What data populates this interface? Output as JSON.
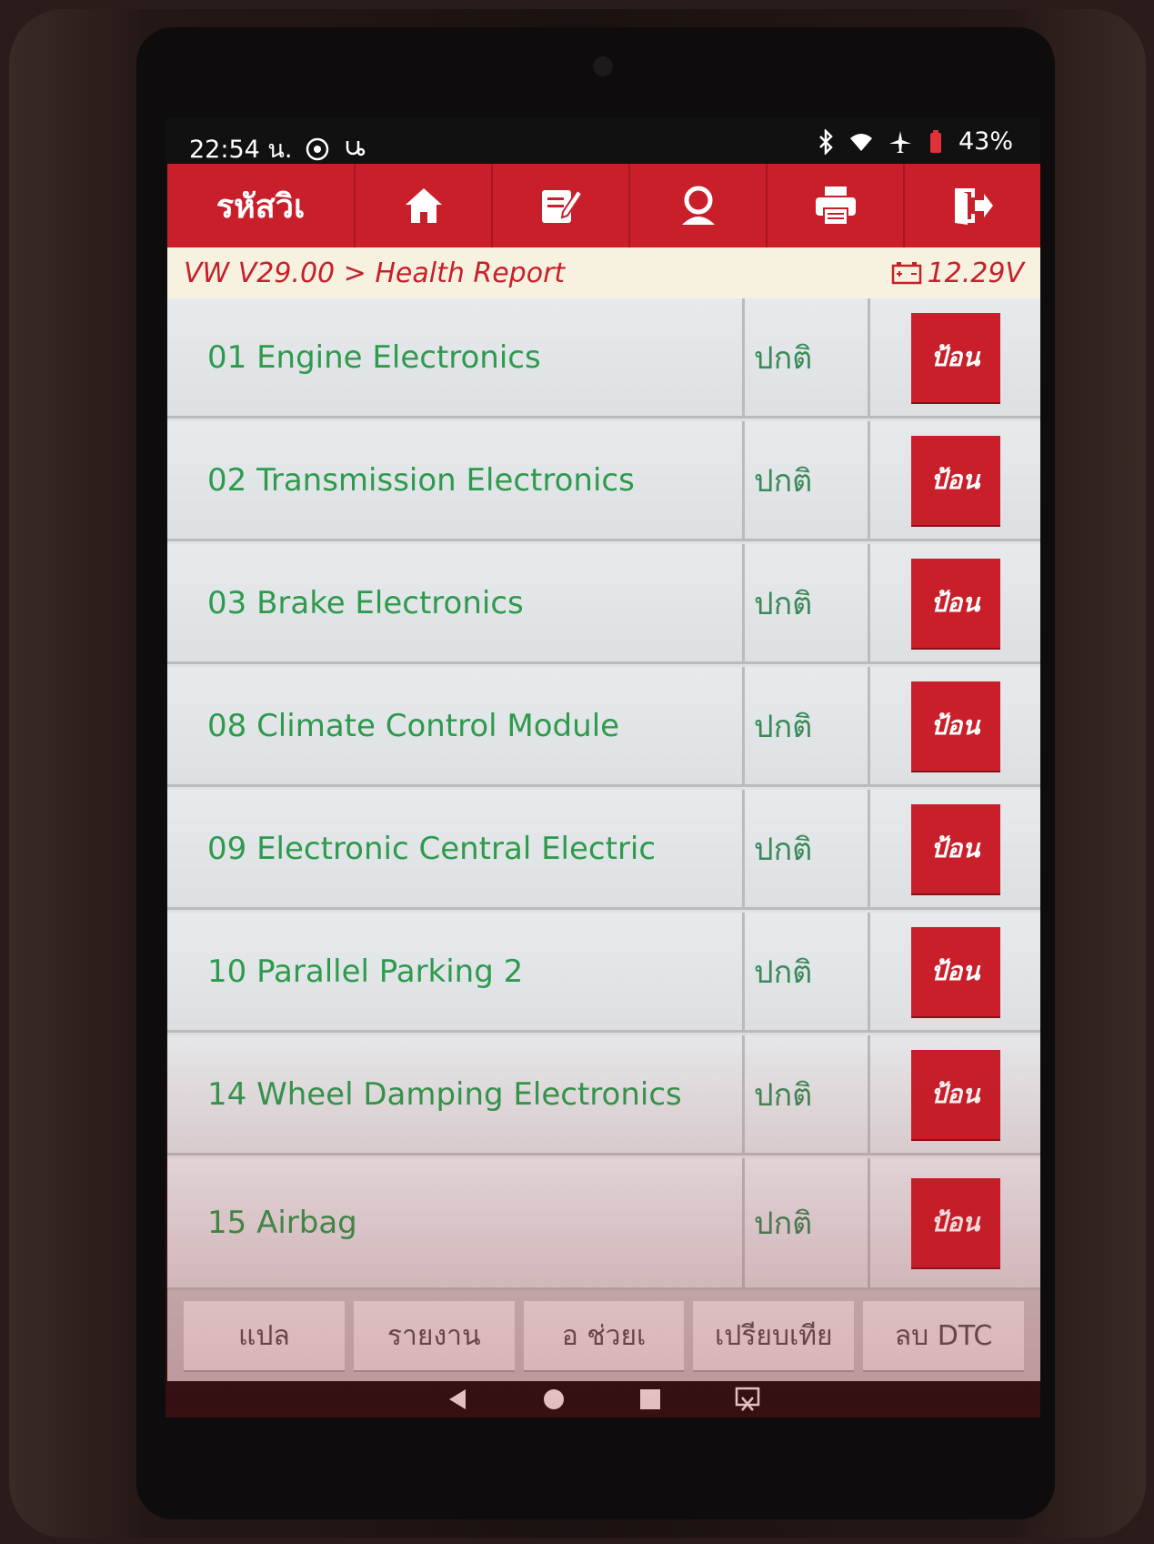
{
  "status_bar": {
    "time": "22:54 น.",
    "battery": "43%"
  },
  "toolbar": {
    "title": "รหัสวิเ",
    "buttons": [
      {
        "icon": "home-icon"
      },
      {
        "icon": "edit-note-icon"
      },
      {
        "icon": "support-agent-icon"
      },
      {
        "icon": "print-icon"
      },
      {
        "icon": "exit-icon"
      }
    ]
  },
  "breadcrumb": {
    "path": "VW V29.00 > Health Report",
    "voltage": "12.29V"
  },
  "systems": [
    {
      "name": "01 Engine Electronics",
      "status": "ปกติ",
      "action": "ป้อน"
    },
    {
      "name": "02 Transmission Electronics",
      "status": "ปกติ",
      "action": "ป้อน"
    },
    {
      "name": "03 Brake Electronics",
      "status": "ปกติ",
      "action": "ป้อน"
    },
    {
      "name": "08 Climate Control Module",
      "status": "ปกติ",
      "action": "ป้อน"
    },
    {
      "name": "09 Electronic Central Electric",
      "status": "ปกติ",
      "action": "ป้อน"
    },
    {
      "name": "10 Parallel Parking 2",
      "status": "ปกติ",
      "action": "ป้อน"
    },
    {
      "name": "14 Wheel Damping Electronics",
      "status": "ปกติ",
      "action": "ป้อน"
    },
    {
      "name": "15 Airbag",
      "status": "ปกติ",
      "action": "ป้อน"
    }
  ],
  "bottom_bar": {
    "translate": "แปล",
    "report": "รายงาน",
    "help": "อ      ช่วยเ",
    "compare": "เปรียบเทีย",
    "clear_dtc": "ลบ DTC"
  },
  "colors": {
    "brand_red": "#c81f2a",
    "item_green": "#2e9a4d",
    "breadcrumb_bg": "#f6f2df"
  }
}
